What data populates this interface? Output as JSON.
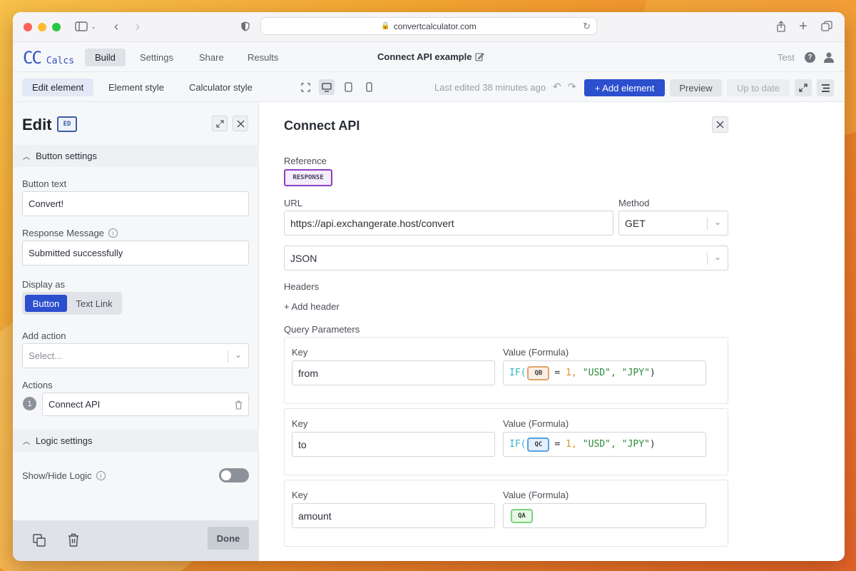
{
  "browser": {
    "url": "convertcalculator.com"
  },
  "app": {
    "logo_cc": "CC",
    "logo_calcs": "Calcs",
    "nav": [
      "Build",
      "Settings",
      "Share",
      "Results"
    ],
    "project_title": "Connect API example",
    "user_label": "Test"
  },
  "toolbar": {
    "tabs": [
      "Edit element",
      "Element style",
      "Calculator style"
    ],
    "last_edited": "Last edited 38 minutes ago",
    "add_element": "+ Add element",
    "preview": "Preview",
    "up_to_date": "Up to date"
  },
  "left": {
    "title": "Edit",
    "badge": "ED",
    "button_settings": "Button settings",
    "button_text_label": "Button text",
    "button_text_value": "Convert!",
    "response_label": "Response Message",
    "response_value": "Submitted successfully",
    "display_as_label": "Display as",
    "display_options": [
      "Button",
      "Text Link"
    ],
    "add_action_label": "Add action",
    "add_action_placeholder": "Select...",
    "actions_label": "Actions",
    "action_number": "1",
    "action_name": "Connect API",
    "logic_settings": "Logic settings",
    "show_hide_label": "Show/Hide Logic",
    "done": "Done"
  },
  "main": {
    "title": "Connect API",
    "reference_label": "Reference",
    "reference_value": "RESPONSE",
    "url_label": "URL",
    "url_value": "https://api.exchangerate.host/convert",
    "method_label": "Method",
    "method_value": "GET",
    "format_value": "JSON",
    "headers_label": "Headers",
    "add_header": "+ Add header",
    "query_label": "Query Parameters",
    "params": [
      {
        "key_label": "Key",
        "key": "from",
        "value_label": "Value (Formula)",
        "formula": {
          "fn": "IF(",
          "ref": "QB",
          "op": "=",
          "num": "1,",
          "s1": "\"USD\",",
          "s2": "\"JPY\"",
          "close": ")"
        }
      },
      {
        "key_label": "Key",
        "key": "to",
        "value_label": "Value (Formula)",
        "formula": {
          "fn": "IF(",
          "ref": "QC",
          "op": "=",
          "num": "1,",
          "s1": "\"USD\",",
          "s2": "\"JPY\"",
          "close": ")"
        }
      },
      {
        "key_label": "Key",
        "key": "amount",
        "value_label": "Value (Formula)",
        "formula": {
          "ref": "QA"
        }
      }
    ]
  },
  "colors": {
    "primary": "#2c4fce",
    "reference_border": "#8a3fc0",
    "chip_qb": "#e1a36b",
    "chip_qc": "#5a9fe0",
    "chip_qa": "#7ed37a",
    "code_fn": "#33b5c9",
    "code_num": "#d9932c",
    "code_str": "#2e8b3a"
  }
}
